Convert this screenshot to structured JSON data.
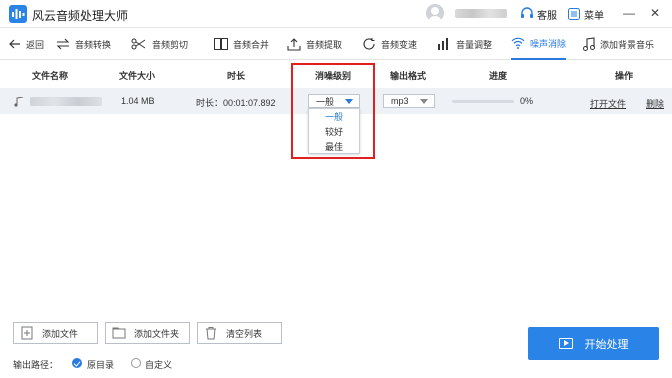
{
  "app": {
    "title": "风云音频处理大师"
  },
  "header": {
    "service": "客服",
    "menu": "菜单",
    "minimize": "—",
    "close": "✕"
  },
  "toolbar": {
    "back": "返回",
    "items": [
      {
        "label": "音频转换"
      },
      {
        "label": "音频剪切"
      },
      {
        "label": "音频合并"
      },
      {
        "label": "音频提取"
      },
      {
        "label": "音频变速"
      },
      {
        "label": "音量调整"
      },
      {
        "label": "噪声消除"
      },
      {
        "label": "添加背景音乐"
      }
    ],
    "active": "噪声消除",
    "accent": "#2a7be0"
  },
  "table": {
    "columns": [
      "文件名称",
      "文件大小",
      "时长",
      "消噪级别",
      "输出格式",
      "进度",
      "操作"
    ],
    "row": {
      "size": "1.04 MB",
      "duration": "时长：00:01:07.892",
      "denoise_level": "一般",
      "format": "mp3",
      "progress_text": "0%",
      "progress": 0,
      "open_file": "打开文件",
      "delete": "删除"
    },
    "dropdown_options": [
      "一般",
      "较好",
      "最佳"
    ]
  },
  "bottom": {
    "add_file": "添加文件",
    "add_folder": "添加文件夹",
    "clear_list": "清空列表",
    "start": "开始处理",
    "output_path_label": "输出路径：",
    "option_original": "原目录",
    "option_custom": "自定义"
  },
  "colors": {
    "primary": "#2a84e8",
    "highlight_box": "#e02020"
  }
}
